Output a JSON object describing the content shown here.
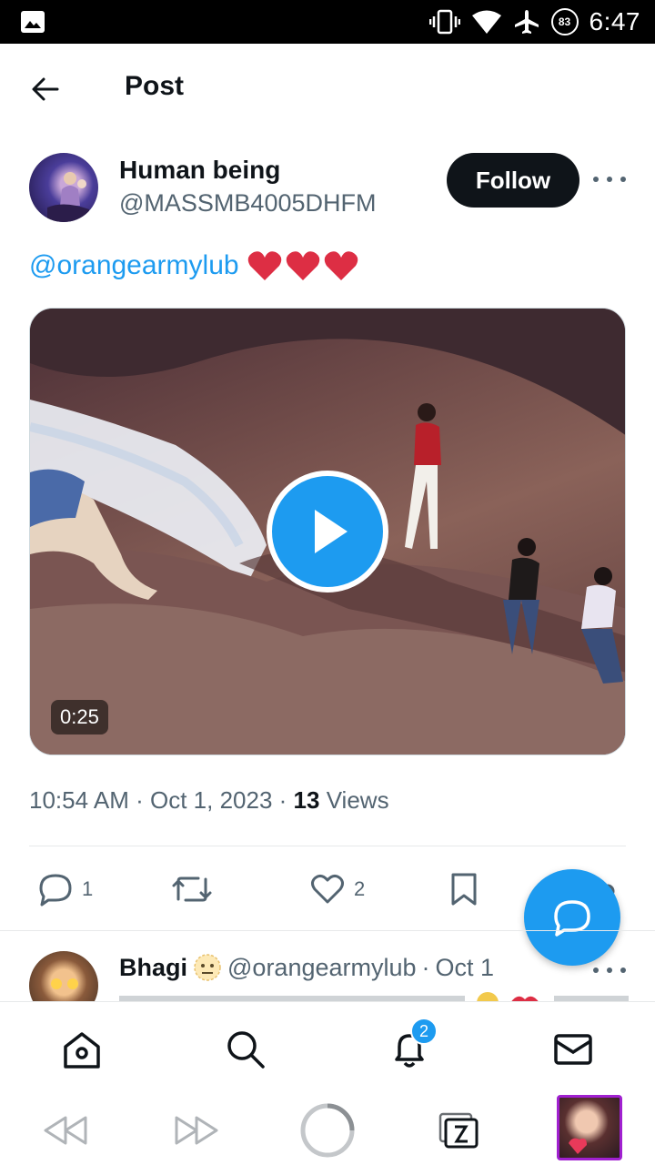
{
  "status_bar": {
    "time": "6:47",
    "battery": "83"
  },
  "header": {
    "title": "Post"
  },
  "author": {
    "name": "Human being",
    "handle": "@MASSMB4005DHFM",
    "follow_label": "Follow"
  },
  "post": {
    "mention": "@orangearmylub",
    "hearts": 3,
    "video_duration": "0:25",
    "time": "10:54 AM",
    "date": "Oct 1, 2023",
    "views_count": "13",
    "views_label": "Views"
  },
  "actions": {
    "replies": "1",
    "likes": "2"
  },
  "reply": {
    "name": "Bhagi",
    "handle": "@orangearmylub",
    "date": "Oct 1"
  },
  "nav": {
    "notifications_badge": "2"
  },
  "colors": {
    "accent": "#1d9bf0",
    "text": "#0f1419",
    "muted": "#536471",
    "heart": "#e0245e"
  }
}
